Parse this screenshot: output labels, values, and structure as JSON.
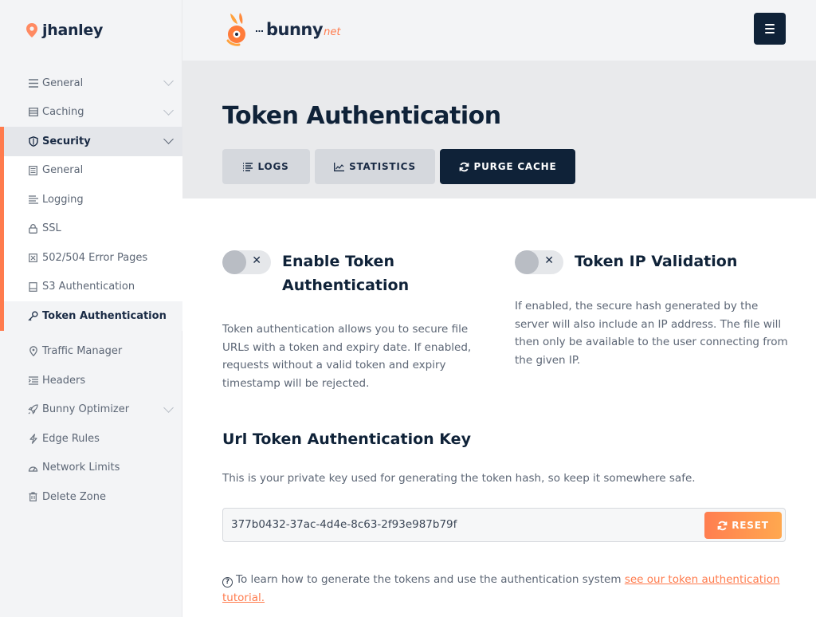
{
  "sidebar": {
    "username": "jhanley",
    "items": [
      {
        "label": "General",
        "icon": "list-icon",
        "chevron": true
      },
      {
        "label": "Caching",
        "icon": "storage-icon",
        "chevron": true
      },
      {
        "label": "Security",
        "icon": "shield-icon",
        "chevron": true,
        "expanded": true
      }
    ],
    "security_sub": [
      {
        "label": "General",
        "icon": "document-icon"
      },
      {
        "label": "Logging",
        "icon": "lines-icon"
      },
      {
        "label": "SSL",
        "icon": "lock-icon"
      },
      {
        "label": "502/504 Error Pages",
        "icon": "error-icon"
      },
      {
        "label": "S3 Authentication",
        "icon": "bucket-icon"
      },
      {
        "label": "Token Authentication",
        "icon": "key-icon",
        "current": true
      }
    ],
    "items_after": [
      {
        "label": "Traffic Manager",
        "icon": "pin-icon"
      },
      {
        "label": "Headers",
        "icon": "headers-icon"
      },
      {
        "label": "Bunny Optimizer",
        "icon": "rocket-icon",
        "chevron": true
      },
      {
        "label": "Edge Rules",
        "icon": "bolt-icon"
      },
      {
        "label": "Network Limits",
        "icon": "gauge-icon"
      },
      {
        "label": "Delete Zone",
        "icon": "trash-icon"
      }
    ]
  },
  "header": {
    "logo_text": "bunny",
    "logo_suffix": "net",
    "menu_icon": "hamburger-icon"
  },
  "page": {
    "title": "Token Authentication",
    "tabs": [
      {
        "label": "LOGS",
        "icon": "logs-icon"
      },
      {
        "label": "STATISTICS",
        "icon": "chart-icon"
      },
      {
        "label": "PURGE CACHE",
        "icon": "refresh-icon"
      }
    ]
  },
  "options": {
    "enable_token": {
      "title_line1": "Enable Token",
      "title_line2": "Authentication",
      "enabled": false,
      "description": "Token authentication allows you to secure file URLs with a token and expiry date. If enabled, requests without a valid token and expiry timestamp will be rejected."
    },
    "ip_validation": {
      "title": "Token IP Validation",
      "enabled": false,
      "description": "If enabled, the secure hash generated by the server will also include an IP address. The file will then only be available to the user connecting from the given IP."
    }
  },
  "key_section": {
    "title": "Url Token Authentication Key",
    "description": "This is your private key used for generating the token hash, so keep it somewhere safe.",
    "key_value": "377b0432-37ac-4d4e-8c63-2f93e987b79f",
    "reset_label": "RESET"
  },
  "help": {
    "text": "To learn how to generate the tokens and use the authentication system ",
    "link_text": "see our token authentication tutorial."
  },
  "colors": {
    "accent": "#ff7b4d",
    "navy": "#0f2238",
    "sidebar_bg": "#f3f4f6"
  }
}
